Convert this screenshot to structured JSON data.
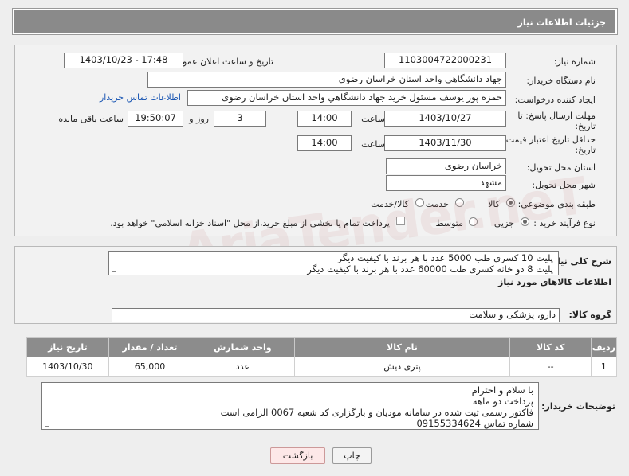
{
  "header": {
    "title": "جزئیات اطلاعات نیاز"
  },
  "need_number": {
    "label": "شماره نیاز:",
    "value": "1103004722000231"
  },
  "announce_datetime": {
    "label": "تاریخ و ساعت اعلان عمومی:",
    "value": "1403/10/23 - 17:48"
  },
  "buyer_org": {
    "label": "نام دستگاه خریدار:",
    "value": "جهاد دانشگاهي واحد استان خراسان رضوی"
  },
  "requester": {
    "label": "ایجاد کننده درخواست:",
    "value": "حمزه  پور یوسف مسئول خرید جهاد دانشگاهي واحد استان خراسان رضوی",
    "contact_link": "اطلاعات تماس خریدار"
  },
  "send_deadline": {
    "label_line1": "مهلت ارسال پاسخ: تا",
    "label_line2": "تاریخ:",
    "date": "1403/10/27",
    "time_label": "ساعت",
    "time": "14:00",
    "days": "3",
    "days_label": "روز و",
    "remaining": "19:50:07",
    "remaining_label": "ساعت باقی مانده"
  },
  "price_validity": {
    "label_line1": "حداقل تاریخ اعتبار قیمت: تا",
    "label_line2": "تاریخ:",
    "date": "1403/11/30",
    "time_label": "ساعت",
    "time": "14:00"
  },
  "delivery_province": {
    "label": "استان محل تحویل:",
    "value": "خراسان رضوی"
  },
  "delivery_city": {
    "label": "شهر محل تحویل:",
    "value": "مشهد"
  },
  "category": {
    "label": "طبقه بندی موضوعی:",
    "options": [
      "کالا",
      "خدمت",
      "کالا/خدمت"
    ],
    "selected": "کالا"
  },
  "process_type": {
    "label": "نوع فرآیند خرید :",
    "options": [
      "جزیی",
      "متوسط"
    ],
    "selected": "جزیی",
    "payment_note": "پرداخت تمام یا بخشی از مبلغ خرید،از محل \"اسناد خزانه اسلامی\" خواهد بود."
  },
  "general_desc": {
    "label": "شرح کلی نیاز:",
    "lines": [
      "پلیت 10 کسری طب 5000 عدد با هر برند با کیفیت دیگر",
      "پلیت 8 دو خانه کسری طب 60000 عدد با هر برند با کیفیت دیگر"
    ]
  },
  "goods_section_title": "اطلاعات کالاهای مورد نیاز",
  "goods_group": {
    "label": "گروه کالا:",
    "value": "دارو، پزشکی و سلامت"
  },
  "goods_table": {
    "headers": [
      "ردیف",
      "کد کالا",
      "نام کالا",
      "واحد شمارش",
      "تعداد / مقدار",
      "تاریخ نیاز"
    ],
    "rows": [
      [
        "1",
        "--",
        "پتری دیش",
        "عدد",
        "65,000",
        "1403/10/30"
      ]
    ]
  },
  "buyer_notes": {
    "label": "توضیحات خریدار:",
    "lines": [
      "با سلام و احترام",
      "پرداخت دو ماهه",
      "فاکتور رسمی ثبت شده در سامانه مودیان و بارگزاری کد شعبه 0067 الزامی است",
      "شماره تماس 09155334624"
    ]
  },
  "buttons": {
    "print": "چاپ",
    "back": "بازگشت"
  }
}
